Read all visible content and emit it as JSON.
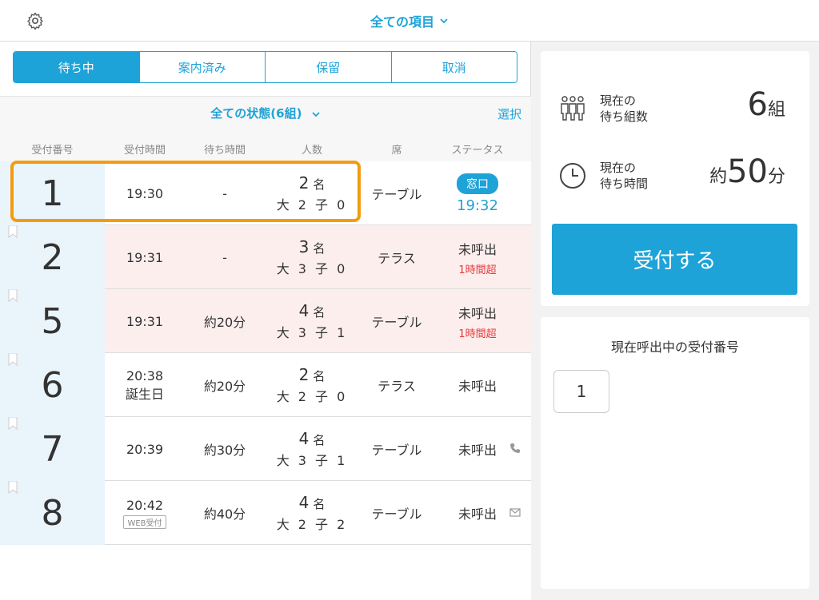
{
  "header": {
    "title": "全ての項目"
  },
  "tabs": [
    "待ち中",
    "案内済み",
    "保留",
    "取消"
  ],
  "filter": {
    "title": "全ての状態(6組)",
    "select_label": "選択"
  },
  "columns": [
    "受付番号",
    "受付時間",
    "待ち時間",
    "人数",
    "席",
    "ステータス"
  ],
  "rows": [
    {
      "number": "1",
      "time": "19:30",
      "wait": "-",
      "count": "2",
      "unit": "名",
      "breakdown": "大 2 子 0",
      "seat": "テーブル",
      "status": "窓口",
      "status_time": "19:32"
    },
    {
      "number": "2",
      "time": "19:31",
      "wait": "-",
      "count": "3",
      "unit": "名",
      "breakdown": "大 3 子 0",
      "seat": "テラス",
      "status": "未呼出",
      "warning": "1時間超"
    },
    {
      "number": "5",
      "time": "19:31",
      "wait": "約20分",
      "count": "4",
      "unit": "名",
      "breakdown": "大 3 子 1",
      "seat": "テーブル",
      "status": "未呼出",
      "warning": "1時間超"
    },
    {
      "number": "6",
      "time": "20:38",
      "note": "誕生日",
      "wait": "約20分",
      "count": "2",
      "unit": "名",
      "breakdown": "大 2 子 0",
      "seat": "テラス",
      "status": "未呼出"
    },
    {
      "number": "7",
      "time": "20:39",
      "wait": "約30分",
      "count": "4",
      "unit": "名",
      "breakdown": "大 3 子 1",
      "seat": "テーブル",
      "status": "未呼出"
    },
    {
      "number": "8",
      "time": "20:42",
      "tag": "WEB受付",
      "wait": "約40分",
      "count": "4",
      "unit": "名",
      "breakdown": "大 2 子 2",
      "seat": "テーブル",
      "status": "未呼出"
    }
  ],
  "stats": {
    "groups_label_1": "現在の",
    "groups_label_2": "待ち組数",
    "groups_value": "6",
    "groups_unit": "組",
    "wait_label_1": "現在の",
    "wait_label_2": "待ち時間",
    "wait_prefix": "約",
    "wait_value": "50",
    "wait_unit": "分"
  },
  "register_button": "受付する",
  "calling": {
    "title": "現在呼出中の受付番号",
    "number": "1"
  },
  "colors": {
    "accent": "#1ea3d8",
    "alert": "#e23a3a",
    "highlight": "#f39c12"
  }
}
